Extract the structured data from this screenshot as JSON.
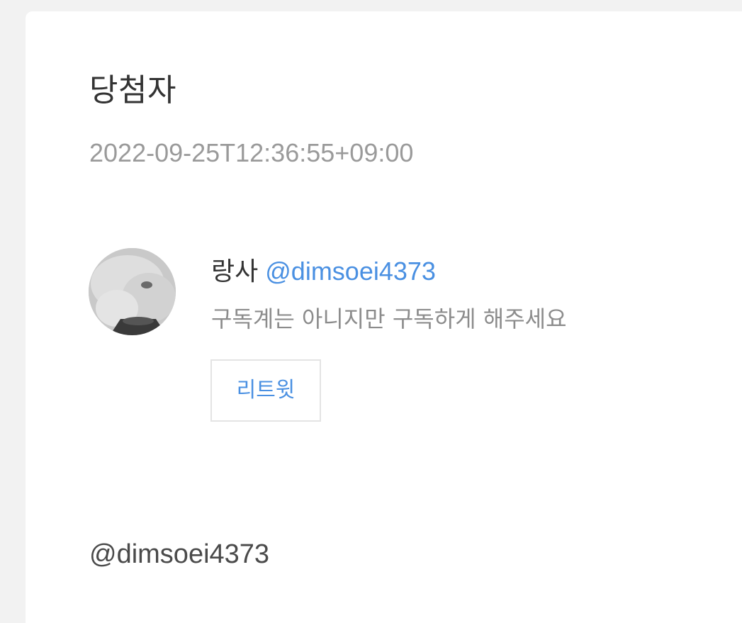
{
  "header": {
    "title": "당첨자",
    "timestamp": "2022-09-25T12:36:55+09:00"
  },
  "winner": {
    "avatar_icon": "user-avatar",
    "name": "랑사",
    "handle": "@dimsoei4373",
    "comment": "구독계는 아니지만 구독하게 해주세요",
    "retweet_label": "리트윗"
  },
  "footer": {
    "handle": "@dimsoei4373"
  },
  "colors": {
    "accent": "#4a90e2",
    "muted_text": "#9a9a9a",
    "background": "#f2f2f2",
    "card": "#ffffff"
  }
}
